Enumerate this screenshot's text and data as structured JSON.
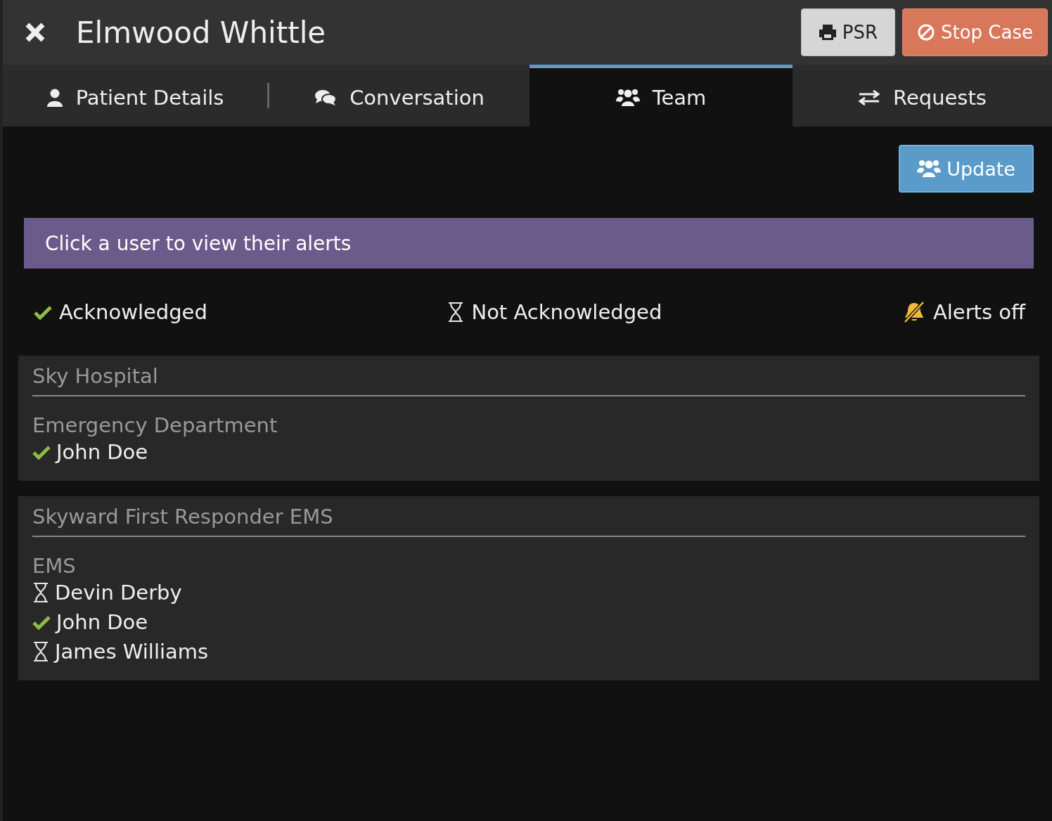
{
  "header": {
    "title": "Elmwood Whittle",
    "buttons": [
      {
        "label": "PSR",
        "kind": "print"
      },
      {
        "label": "Stop Case",
        "kind": "stop"
      }
    ]
  },
  "tabs": [
    {
      "label": "Patient Details",
      "selected": false
    },
    {
      "label": "Conversation",
      "selected": false
    },
    {
      "label": "Team",
      "selected": true
    },
    {
      "label": "Requests",
      "selected": false
    }
  ],
  "update_button": "Update",
  "info_banner": "Click a user to view their alerts",
  "legend": [
    {
      "label": "Acknowledged",
      "kind": "acknowledged"
    },
    {
      "label": "Not Acknowledged",
      "kind": "pending"
    },
    {
      "label": "Alerts off",
      "kind": "alerts_off"
    }
  ],
  "organizations": [
    {
      "name": "Sky Hospital",
      "departments": [
        {
          "name": "Emergency Department",
          "members": [
            {
              "name": "John Doe",
              "acknowledged": true
            }
          ]
        }
      ]
    },
    {
      "name": "Skyward First Responder EMS",
      "departments": [
        {
          "name": "EMS",
          "members": [
            {
              "name": "Devin Derby",
              "acknowledged": false
            },
            {
              "name": "John Doe",
              "acknowledged": true
            },
            {
              "name": "James Williams",
              "acknowledged": false
            }
          ]
        }
      ]
    }
  ]
}
